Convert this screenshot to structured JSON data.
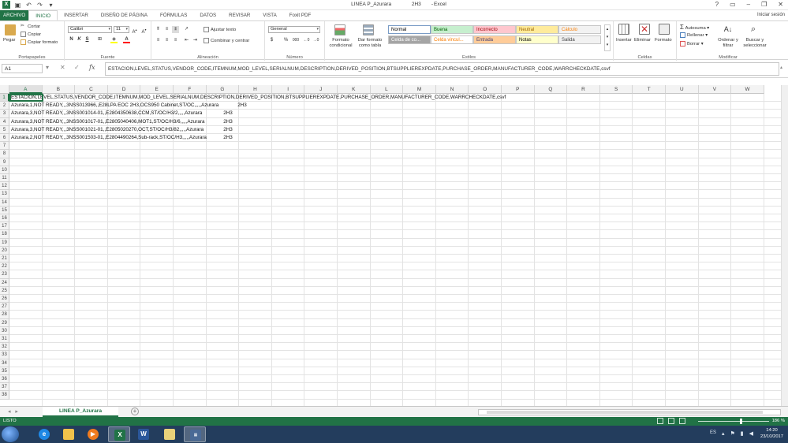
{
  "window": {
    "title": "LINEA P_Azurara",
    "cell_ref": "2H3",
    "app": "Excel",
    "separator": "-"
  },
  "ribbon_tabs": [
    "ARCHIVO",
    "INICIO",
    "INSERTAR",
    "DISEÑO DE PÁGINA",
    "FÓRMULAS",
    "DATOS",
    "REVISAR",
    "VISTA",
    "Foxit PDF"
  ],
  "user": "Iniciar sesión",
  "clipboard": {
    "paste": "Pegar",
    "cut": "Cortar",
    "copy": "Copiar",
    "format_painter": "Copiar formato",
    "label": "Portapapeles"
  },
  "font": {
    "name": "Calibri",
    "size": "11",
    "label": "Fuente",
    "bold": "N",
    "italic": "K",
    "underline": "S"
  },
  "alignment": {
    "wrap": "Ajustar texto",
    "merge": "Combinar y centrar",
    "label": "Alineación"
  },
  "number": {
    "format": "General",
    "percent": "%",
    "thousands": "000",
    "label": "Número"
  },
  "styles": {
    "conditional": "Formato condicional",
    "as_table": "Dar formato como tabla",
    "label": "Estilos",
    "cells": [
      {
        "text": "Normal",
        "bg": "#ffffff",
        "fg": "#000000"
      },
      {
        "text": "Buena",
        "bg": "#c6efce",
        "fg": "#006100"
      },
      {
        "text": "Incorrecto",
        "bg": "#ffc7ce",
        "fg": "#9c0006"
      },
      {
        "text": "Neutral",
        "bg": "#ffeb9c",
        "fg": "#9c6500"
      },
      {
        "text": "Cálculo",
        "bg": "#f2f2f2",
        "fg": "#fa7d00"
      },
      {
        "text": "Celda de co...",
        "bg": "#a5a5a5",
        "fg": "#ffffff"
      },
      {
        "text": "Celda vincul...",
        "bg": "#ffffff",
        "fg": "#fa7d00"
      },
      {
        "text": "Entrada",
        "bg": "#ffcc99",
        "fg": "#3f3f76"
      },
      {
        "text": "Notas",
        "bg": "#ffffcc",
        "fg": "#000000"
      },
      {
        "text": "Salida",
        "bg": "#f2f2f2",
        "fg": "#3f3f3f"
      }
    ]
  },
  "cells_group": {
    "insert": "Insertar",
    "delete": "Eliminar",
    "format": "Formato",
    "label": "Celdas"
  },
  "editing": {
    "autosum": "Autosuma",
    "fill": "Rellenar",
    "clear": "Borrar",
    "sort": "Ordenar y filtrar",
    "find": "Buscar y seleccionar",
    "label": "Modificar"
  },
  "formula_bar": {
    "name_box": "A1",
    "fx": "fx",
    "content": "ESTACION,LEVEL,STATUS,VENDOR_CODE,ITEMNUM,MOD_LEVEL,SERIALNUM,DESCRIPTION,DERIVED_POSITION,BTSUPPLIEREXPDATE,PURCHASE_ORDER,MANUFACTURER_CODE,WARRCHECKDATE,csvf"
  },
  "columns": [
    "A",
    "B",
    "C",
    "D",
    "E",
    "F",
    "G",
    "H",
    "I",
    "J",
    "K",
    "L",
    "M",
    "N",
    "O",
    "P",
    "Q",
    "R",
    "S",
    "T",
    "U",
    "V",
    "W"
  ],
  "row_count": 38,
  "rows": [
    {
      "text": "ESTACION,LEVEL,STATUS,VENDOR_CODE,ITEMNUM,MOD_LEVEL,SERIALNUM,DESCRIPTION,DERIVED_POSITION,BTSUPPLIEREXPDATE,PURCHASE_ORDER,MANUFACTURER_CODE,WARRCHECKDATE,csvf",
      "h": ""
    },
    {
      "text": "Azurara,1,NOT READY,,,3NSS013966,,E28LPA EOC 2H3,OCS950 Cabinet,ST/OC,,,,,Azurara",
      "h": "2H3"
    },
    {
      "text": "Azurara,3,NOT READY,,,3NSS001014-01,,E2804350638,CCM,ST/OC/H3/2,,,,,Azurara",
      "h": "2H3"
    },
    {
      "text": "Azurara,3,NOT READY,,,3NSS001017-01,,E2805040406,MOT1,ST/OC/H3/6,,,,,Azurara",
      "h": "2H3"
    },
    {
      "text": "Azurara,3,NOT READY,,,3NSS001021-01,,E2805020270,OCT,ST/OC/H3/82,,,,,Azurara",
      "h": "2H3"
    },
    {
      "text": "Azurara,2,NOT READY,,,3NSS001503-01,,E2804490264,Sub-rack,ST/OC/H3,,,,,Azurara",
      "h": "2H3"
    }
  ],
  "sheet": {
    "tab": "LINEA P_Azurara"
  },
  "status": {
    "ready": "LISTO",
    "zoom": "186 %"
  },
  "taskbar": {
    "lang": "ES",
    "time": "14:20",
    "date": "23/10/2017"
  }
}
